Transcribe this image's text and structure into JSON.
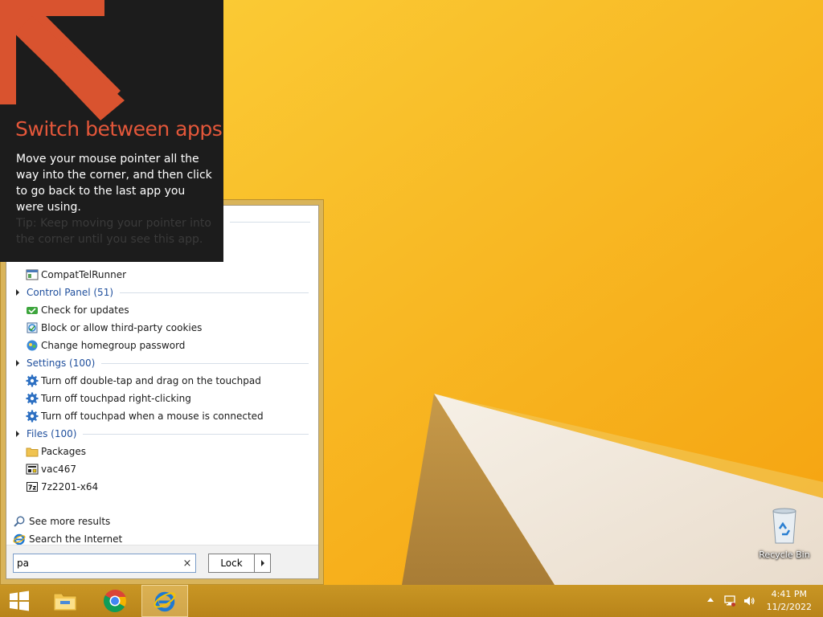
{
  "tip": {
    "title": "Switch between apps",
    "body": "Move your mouse pointer all the way into the corner, and then click to go back to the last app you were using.",
    "hint": "Tip: Keep moving your pointer into the corner until you see this app."
  },
  "start_menu": {
    "groups": [
      {
        "label": "Control Panel (51)",
        "items": [
          {
            "label": "Check for updates",
            "icon": "windows-update-icon"
          },
          {
            "label": "Block or allow third-party cookies",
            "icon": "internet-options-icon"
          },
          {
            "label": "Change homegroup password",
            "icon": "homegroup-icon"
          }
        ]
      },
      {
        "label": "Settings (100)",
        "items": [
          {
            "label": "Turn off double-tap and drag on the touchpad",
            "icon": "gear-icon"
          },
          {
            "label": "Turn off touchpad right-clicking",
            "icon": "gear-icon"
          },
          {
            "label": "Turn off touchpad when a mouse is connected",
            "icon": "gear-icon"
          }
        ]
      },
      {
        "label": "Files (100)",
        "items": [
          {
            "label": "Packages",
            "icon": "folder-icon"
          },
          {
            "label": "vac467",
            "icon": "executable-icon"
          },
          {
            "label": "7z2201-x64",
            "icon": "7zip-icon"
          }
        ]
      }
    ],
    "programs": [
      {
        "label": "CompatTelRunner",
        "icon": "application-icon"
      }
    ],
    "see_more": "See more results",
    "search_internet": "Search the Internet",
    "search": {
      "value": "pa",
      "clear": "×"
    },
    "power_button": "Lock"
  },
  "desktop": {
    "recycle_bin": "Recycle Bin"
  },
  "taskbar": {
    "pinned": [
      "start-button",
      "file-explorer",
      "chrome",
      "internet-explorer"
    ],
    "time": "4:41 PM",
    "date": "11/2/2022"
  },
  "colors": {
    "tip_title": "#e4573a",
    "group_header": "#1e4e9c",
    "taskbar": "#c08c1c",
    "wallpaper": "#f8b418"
  }
}
